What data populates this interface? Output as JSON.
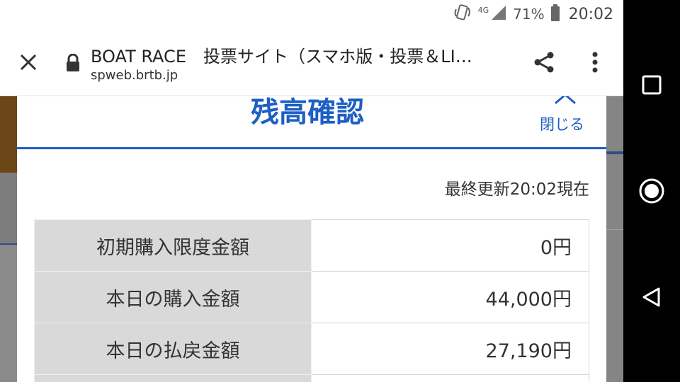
{
  "status_bar": {
    "network": "4G",
    "battery": "71%",
    "time": "20:02"
  },
  "browser": {
    "title": "BOAT RACE　投票サイト（スマホ版・投票＆LI…",
    "url": "spweb.brtb.jp"
  },
  "modal": {
    "title": "残高確認",
    "close_label": "閉じる",
    "updated_text": "最終更新20:02現在",
    "rows": [
      {
        "label": "初期購入限度金額",
        "value": "0円"
      },
      {
        "label": "本日の購入金額",
        "value": "44,000円"
      },
      {
        "label": "本日の払戻金額",
        "value": "27,190円"
      }
    ]
  },
  "colors": {
    "accent": "#1d5fc4",
    "label_bg": "#d9d9d9"
  }
}
